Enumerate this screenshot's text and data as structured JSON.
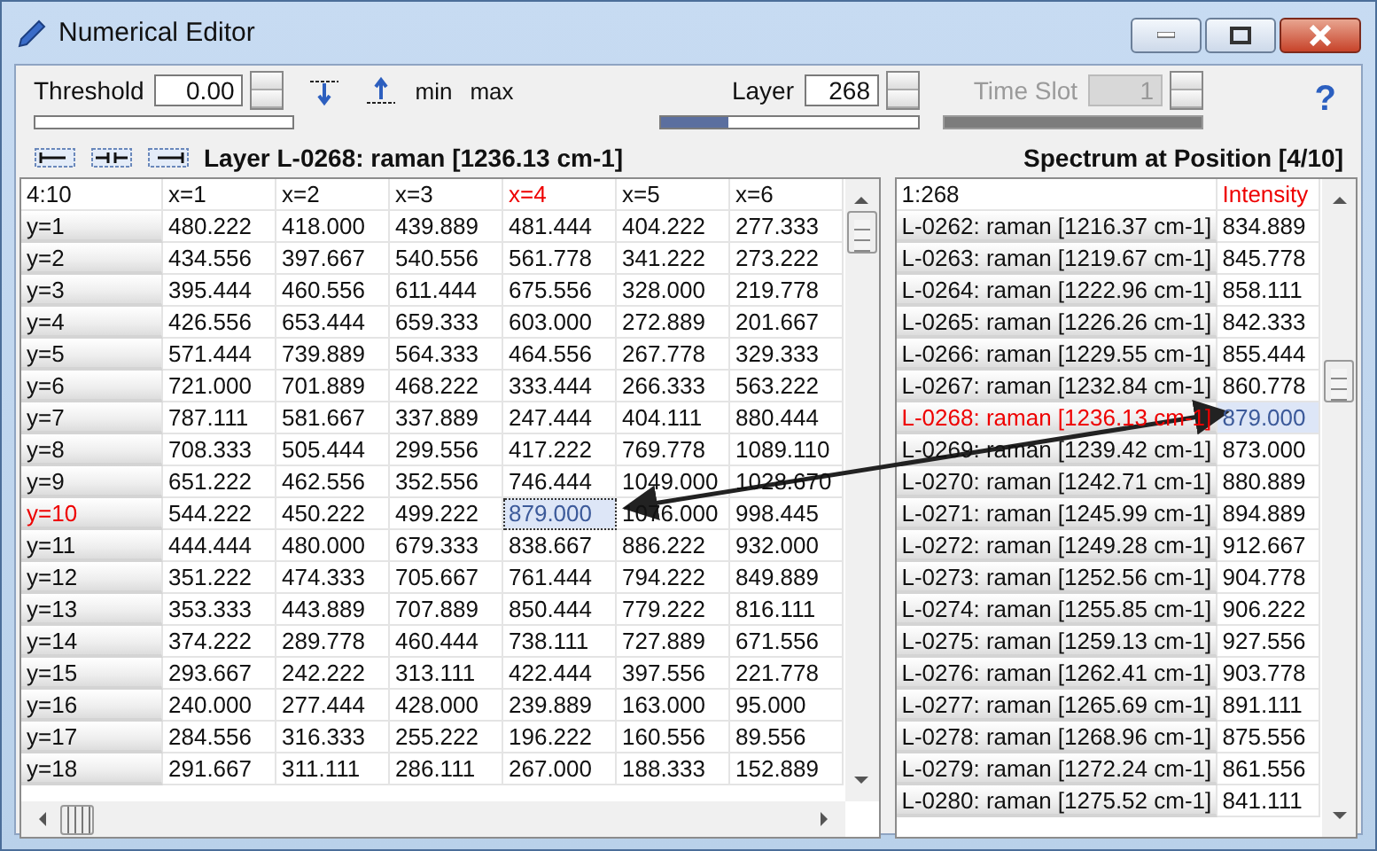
{
  "window": {
    "title": "Numerical Editor",
    "help": "?"
  },
  "toolbar": {
    "threshold": {
      "label": "Threshold",
      "value": "0.00",
      "level": 0
    },
    "min_label": "min",
    "max_label": "max",
    "layer": {
      "label": "Layer",
      "value": "268",
      "level": 0.26
    },
    "time_slot": {
      "label": "Time Slot",
      "value": "1",
      "disabled": true
    }
  },
  "layer_caption": "Layer L-0268: raman [1236.13 cm-1]",
  "spectrum_caption": "Spectrum at Position [4/10]",
  "grid": {
    "corner": "4:10",
    "columns": [
      {
        "label": "x=1",
        "selected": false
      },
      {
        "label": "x=2",
        "selected": false
      },
      {
        "label": "x=3",
        "selected": false
      },
      {
        "label": "x=4",
        "selected": true
      },
      {
        "label": "x=5",
        "selected": false
      },
      {
        "label": "x=6",
        "selected": false
      }
    ],
    "rows": [
      {
        "label": "y=1",
        "selected": false,
        "cells": [
          "480.222",
          "418.000",
          "439.889",
          "481.444",
          "404.222",
          "277.333"
        ]
      },
      {
        "label": "y=2",
        "selected": false,
        "cells": [
          "434.556",
          "397.667",
          "540.556",
          "561.778",
          "341.222",
          "273.222"
        ]
      },
      {
        "label": "y=3",
        "selected": false,
        "cells": [
          "395.444",
          "460.556",
          "611.444",
          "675.556",
          "328.000",
          "219.778"
        ]
      },
      {
        "label": "y=4",
        "selected": false,
        "cells": [
          "426.556",
          "653.444",
          "659.333",
          "603.000",
          "272.889",
          "201.667"
        ]
      },
      {
        "label": "y=5",
        "selected": false,
        "cells": [
          "571.444",
          "739.889",
          "564.333",
          "464.556",
          "267.778",
          "329.333"
        ]
      },
      {
        "label": "y=6",
        "selected": false,
        "cells": [
          "721.000",
          "701.889",
          "468.222",
          "333.444",
          "266.333",
          "563.222"
        ]
      },
      {
        "label": "y=7",
        "selected": false,
        "cells": [
          "787.111",
          "581.667",
          "337.889",
          "247.444",
          "404.111",
          "880.444"
        ]
      },
      {
        "label": "y=8",
        "selected": false,
        "cells": [
          "708.333",
          "505.444",
          "299.556",
          "417.222",
          "769.778",
          "1089.110"
        ]
      },
      {
        "label": "y=9",
        "selected": false,
        "cells": [
          "651.222",
          "462.556",
          "352.556",
          "746.444",
          "1049.000",
          "1028.670"
        ]
      },
      {
        "label": "y=10",
        "selected": true,
        "cells": [
          "544.222",
          "450.222",
          "499.222",
          "879.000",
          "1076.000",
          "998.445"
        ]
      },
      {
        "label": "y=11",
        "selected": false,
        "cells": [
          "444.444",
          "480.000",
          "679.333",
          "838.667",
          "886.222",
          "932.000"
        ]
      },
      {
        "label": "y=12",
        "selected": false,
        "cells": [
          "351.222",
          "474.333",
          "705.667",
          "761.444",
          "794.222",
          "849.889"
        ]
      },
      {
        "label": "y=13",
        "selected": false,
        "cells": [
          "353.333",
          "443.889",
          "707.889",
          "850.444",
          "779.222",
          "816.111"
        ]
      },
      {
        "label": "y=14",
        "selected": false,
        "cells": [
          "374.222",
          "289.778",
          "460.444",
          "738.111",
          "727.889",
          "671.556"
        ]
      },
      {
        "label": "y=15",
        "selected": false,
        "cells": [
          "293.667",
          "242.222",
          "313.111",
          "422.444",
          "397.556",
          "221.778"
        ]
      },
      {
        "label": "y=16",
        "selected": false,
        "cells": [
          "240.000",
          "277.444",
          "428.000",
          "239.889",
          "163.000",
          "95.000"
        ]
      },
      {
        "label": "y=17",
        "selected": false,
        "cells": [
          "284.556",
          "316.333",
          "255.222",
          "196.222",
          "160.556",
          "89.556"
        ]
      },
      {
        "label": "y=18",
        "selected": false,
        "cells": [
          "291.667",
          "311.111",
          "286.111",
          "267.000",
          "188.333",
          "152.889"
        ]
      }
    ]
  },
  "spectrum": {
    "corner": "1:268",
    "value_header": "Intensity",
    "rows": [
      {
        "label": "L-0262: raman [1216.37 cm-1]",
        "value": "834.889",
        "selected": false
      },
      {
        "label": "L-0263: raman [1219.67 cm-1]",
        "value": "845.778",
        "selected": false
      },
      {
        "label": "L-0264: raman [1222.96 cm-1]",
        "value": "858.111",
        "selected": false
      },
      {
        "label": "L-0265: raman [1226.26 cm-1]",
        "value": "842.333",
        "selected": false
      },
      {
        "label": "L-0266: raman [1229.55 cm-1]",
        "value": "855.444",
        "selected": false
      },
      {
        "label": "L-0267: raman [1232.84 cm-1]",
        "value": "860.778",
        "selected": false
      },
      {
        "label": "L-0268: raman [1236.13 cm-1]",
        "value": "879.000",
        "selected": true
      },
      {
        "label": "L-0269: raman [1239.42 cm-1]",
        "value": "873.000",
        "selected": false
      },
      {
        "label": "L-0270: raman [1242.71 cm-1]",
        "value": "880.889",
        "selected": false
      },
      {
        "label": "L-0271: raman [1245.99 cm-1]",
        "value": "894.889",
        "selected": false
      },
      {
        "label": "L-0272: raman [1249.28 cm-1]",
        "value": "912.667",
        "selected": false
      },
      {
        "label": "L-0273: raman [1252.56 cm-1]",
        "value": "904.778",
        "selected": false
      },
      {
        "label": "L-0274: raman [1255.85 cm-1]",
        "value": "906.222",
        "selected": false
      },
      {
        "label": "L-0275: raman [1259.13 cm-1]",
        "value": "927.556",
        "selected": false
      },
      {
        "label": "L-0276: raman [1262.41 cm-1]",
        "value": "903.778",
        "selected": false
      },
      {
        "label": "L-0277: raman [1265.69 cm-1]",
        "value": "891.111",
        "selected": false
      },
      {
        "label": "L-0278: raman [1268.96 cm-1]",
        "value": "875.556",
        "selected": false
      },
      {
        "label": "L-0279: raman [1272.24 cm-1]",
        "value": "861.556",
        "selected": false
      },
      {
        "label": "L-0280: raman [1275.52 cm-1]",
        "value": "841.111",
        "selected": false
      }
    ]
  }
}
